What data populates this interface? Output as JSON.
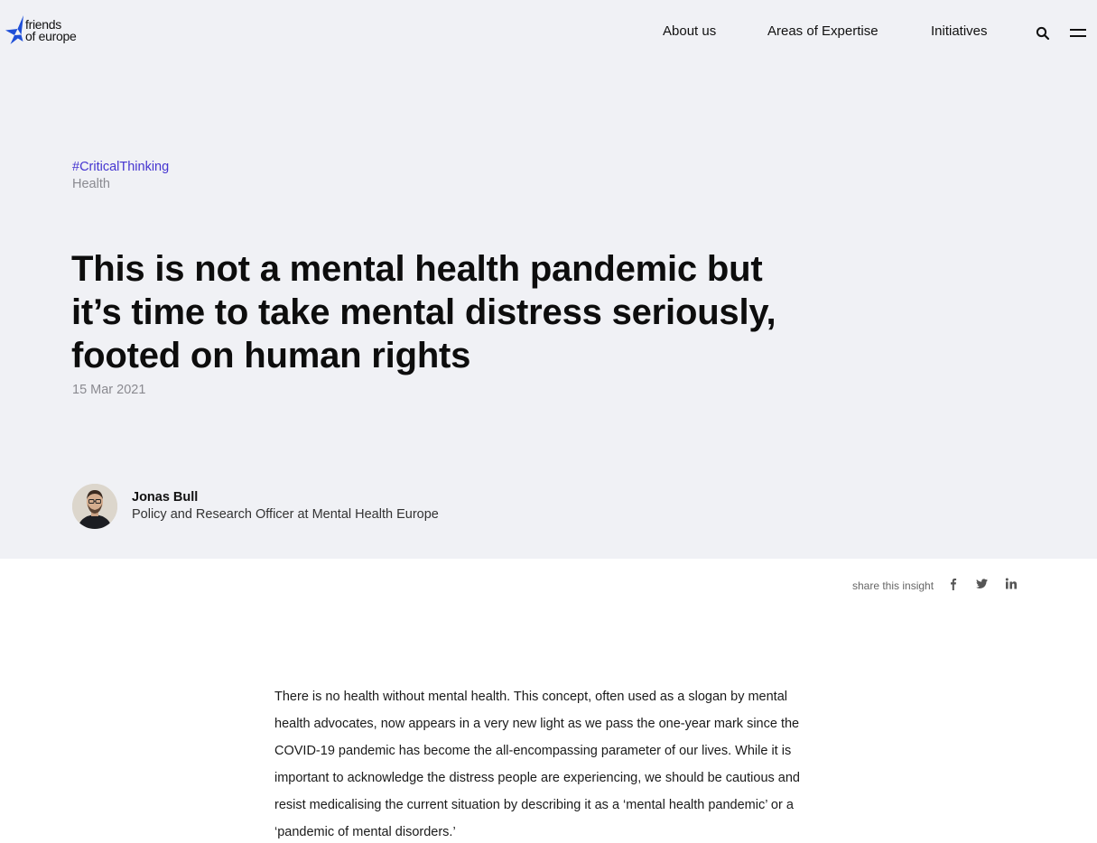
{
  "header": {
    "logo": {
      "line1": "friends",
      "line2": "of europe",
      "star_color": "#1f4fd8"
    },
    "nav": [
      "About us",
      "Areas of Expertise",
      "Initiatives"
    ],
    "icons": {
      "search": "search-icon",
      "menu": "hamburger-menu-icon"
    }
  },
  "hero": {
    "tag": "#CriticalThinking",
    "category": "Health",
    "title": "This is not a mental health pandemic but it’s time to take mental distress seriously, footed on human rights",
    "date": "15 Mar 2021",
    "background": "#f0f1f5",
    "tag_color": "#4535d0"
  },
  "author": {
    "name": "Jonas Bull",
    "role": "Policy and Research Officer at Mental Health Europe"
  },
  "share": {
    "label": "share this insight",
    "icons": [
      "facebook-icon",
      "twitter-icon",
      "linkedin-icon"
    ]
  },
  "article": {
    "paragraph1": "There is no health without mental health. This concept, often used as a slogan by mental health advocates, now appears in a very new light as we pass the one-year mark since the COVID-19 pandemic has become the all-encompassing parameter of our lives. While it is important to acknowledge the distress people are experiencing, we should be cautious and resist medicalising the current situation by describing it as a ‘mental health pandemic’ or a ‘pandemic of mental disorders.’"
  }
}
